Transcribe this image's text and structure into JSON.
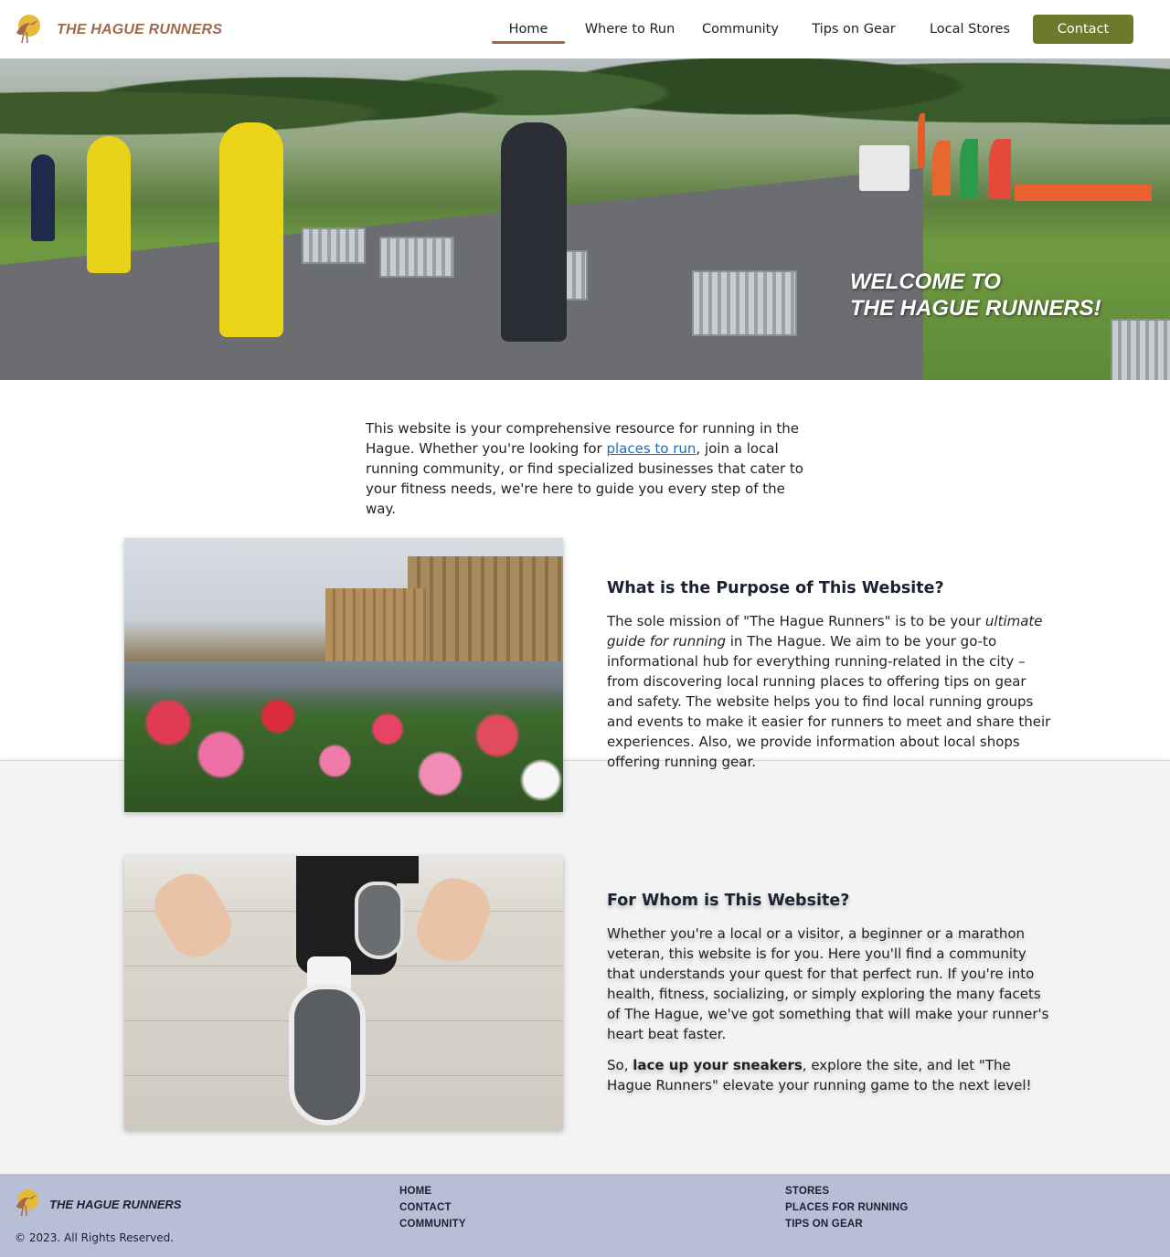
{
  "header": {
    "brand_name": "THE HAGUE RUNNERS",
    "logo_icon": "heron-icon",
    "nav": {
      "home": "Home",
      "where_to_run": "Where to Run",
      "community": "Community",
      "tips_on_gear": "Tips on Gear",
      "local_stores": "Local Stores",
      "contact": "Contact"
    },
    "active_tab": "Home"
  },
  "hero": {
    "line1": "WELCOME TO",
    "line2": "THE HAGUE RUNNERS!"
  },
  "intro": {
    "text_before": "This website is your comprehensive resource for running in the Hague. Whether you're looking for ",
    "link": "places to run",
    "text_after": ", join a local running community, or find specialized businesses that cater to your fitness needs, we're here to guide you every step of the way."
  },
  "purpose": {
    "title": "What is the Purpose of This Website?",
    "text_before": "The sole mission of \"The Hague Runners\" is to be your ",
    "emphasis": "ultimate guide for running",
    "text_after": " in The Hague. We aim to be your go-to informational hub for everything running-related in the city – from discovering local running places to offering tips on gear and safety. The website helps you to find local running groups and events to make it easier for runners to meet and share their experiences. Also, we provide information about local shops offering running gear."
  },
  "audience": {
    "title": "For Whom is This Website?",
    "paragraph1": "Whether you're a local or a visitor, a beginner or a marathon veteran, this website is for you. Here you'll find a community that understands your quest for that perfect run. If you're into health, fitness, socializing, or simply exploring the many facets of The Hague, we've got something that will make your runner's heart beat faster.",
    "p2_before": "So, ",
    "p2_bold": "lace up your sneakers",
    "p2_after": ", explore the site, and let \"The Hague Runners\" elevate your running game to the next level!"
  },
  "footer": {
    "brand_name": "THE HAGUE RUNNERS",
    "copyright": "© 2023. All Rights Reserved.",
    "col1": [
      "HOME",
      "CONTACT",
      "COMMUNITY"
    ],
    "col2": [
      "STORES",
      "PLACES FOR RUNNING",
      "TIPS ON GEAR"
    ]
  },
  "colors": {
    "brand": "#a0694a",
    "contact_button": "#6b7a2d",
    "footer_bg": "#b6bfd6",
    "link": "#1a6fb8"
  }
}
